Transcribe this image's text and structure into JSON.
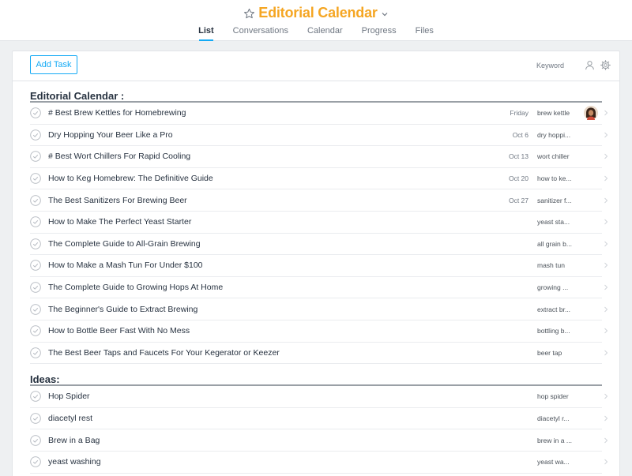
{
  "header": {
    "title": "Editorial Calendar",
    "tabs": [
      {
        "label": "List",
        "active": true
      },
      {
        "label": "Conversations",
        "active": false
      },
      {
        "label": "Calendar",
        "active": false
      },
      {
        "label": "Progress",
        "active": false
      },
      {
        "label": "Files",
        "active": false
      }
    ]
  },
  "toolbar": {
    "add_task_label": "Add Task",
    "keyword_label": "Keyword"
  },
  "sections": [
    {
      "title": "Editorial Calendar :",
      "tasks": [
        {
          "name": "# Best Brew Kettles for Homebrewing",
          "due": "Friday",
          "tag": "brew kettle",
          "has_avatar": true
        },
        {
          "name": "Dry Hopping Your Beer Like a Pro",
          "due": "Oct 6",
          "tag": "dry hoppi..."
        },
        {
          "name": "# Best Wort Chillers For Rapid Cooling",
          "due": "Oct 13",
          "tag": "wort chiller"
        },
        {
          "name": "How to Keg Homebrew: The Definitive Guide",
          "due": "Oct 20",
          "tag": "how to ke..."
        },
        {
          "name": "The Best Sanitizers For Brewing Beer",
          "due": "Oct 27",
          "tag": "sanitizer f..."
        },
        {
          "name": "How to Make The Perfect Yeast Starter",
          "due": "",
          "tag": "yeast sta..."
        },
        {
          "name": "The Complete Guide to All-Grain Brewing",
          "due": "",
          "tag": "all grain b..."
        },
        {
          "name": "How to Make a Mash Tun For Under $100",
          "due": "",
          "tag": "mash tun"
        },
        {
          "name": "The Complete Guide to Growing Hops At Home",
          "due": "",
          "tag": "growing ..."
        },
        {
          "name": "The Beginner's Guide to Extract Brewing",
          "due": "",
          "tag": "extract br..."
        },
        {
          "name": "How to Bottle Beer Fast With No Mess",
          "due": "",
          "tag": "bottling b..."
        },
        {
          "name": "The Best Beer Taps and Faucets For Your Kegerator or Keezer",
          "due": "",
          "tag": "beer tap"
        }
      ]
    },
    {
      "title": "Ideas:",
      "tasks": [
        {
          "name": "Hop Spider",
          "due": "",
          "tag": "hop spider"
        },
        {
          "name": "diacetyl rest",
          "due": "",
          "tag": "diacetyl r..."
        },
        {
          "name": "Brew in a Bag",
          "due": "",
          "tag": "brew in a ..."
        },
        {
          "name": "yeast washing",
          "due": "",
          "tag": "yeast wa..."
        }
      ]
    }
  ],
  "colors": {
    "accent": "#f5a623",
    "link": "#14aaf5",
    "text": "#273240",
    "muted": "#6f7782"
  },
  "icons": {
    "title_star": "star-icon",
    "title_menu": "chevron-down-icon",
    "toolbar_person": "person-icon",
    "toolbar_settings": "gear-icon",
    "task_complete": "check-circle-icon",
    "row_arrow": "chevron-right-icon"
  }
}
